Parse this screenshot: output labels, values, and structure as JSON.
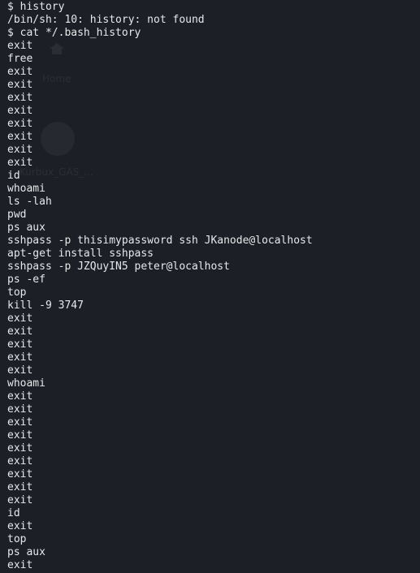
{
  "background": "#1c1f26",
  "text_color": "#e8e8e8",
  "desktop_ghost": {
    "home_icon": "home-icon",
    "home_label": "Home",
    "item_label": "Kurbux_GAS_..."
  },
  "terminal": {
    "lines": [
      "$ history",
      "/bin/sh: 10: history: not found",
      "$ cat */.bash_history",
      "exit",
      "free",
      "exit",
      "exit",
      "exit",
      "exit",
      "exit",
      "exit",
      "exit",
      "exit",
      "id",
      "whoami",
      "ls -lah",
      "pwd",
      "ps aux",
      "sshpass -p thisimypassword ssh JKanode@localhost",
      "apt-get install sshpass",
      "sshpass -p JZQuyIN5 peter@localhost",
      "ps -ef",
      "top",
      "kill -9 3747",
      "exit",
      "exit",
      "exit",
      "exit",
      "exit",
      "whoami",
      "exit",
      "exit",
      "exit",
      "exit",
      "exit",
      "exit",
      "exit",
      "exit",
      "exit",
      "id",
      "exit",
      "top",
      "ps aux",
      "exit"
    ]
  }
}
